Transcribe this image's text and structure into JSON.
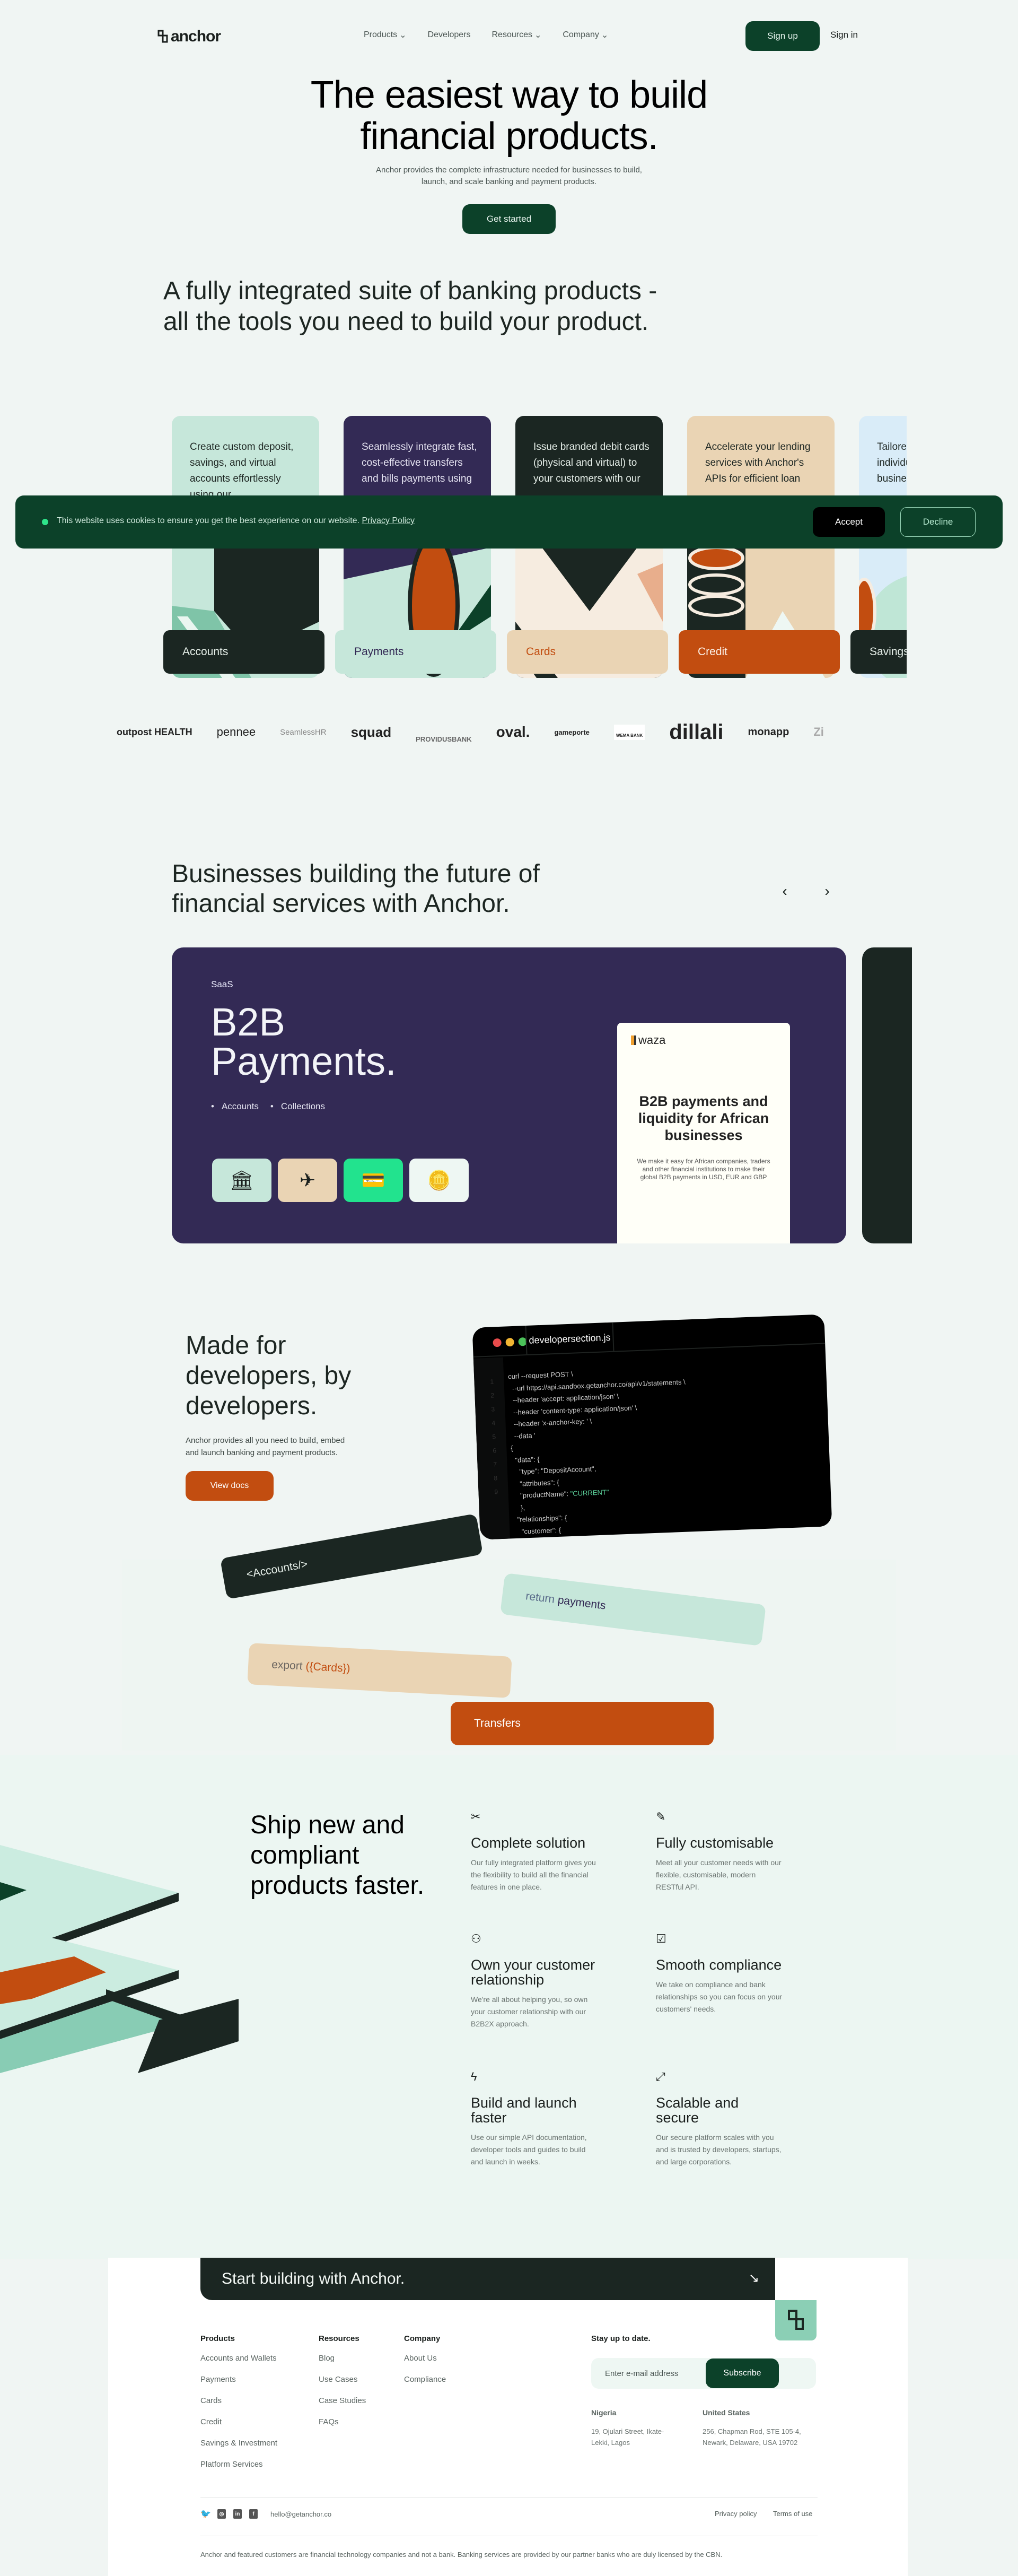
{
  "brand": {
    "name": "anchor"
  },
  "nav": {
    "links": [
      {
        "label": "Products",
        "has_dropdown": true
      },
      {
        "label": "Developers",
        "has_dropdown": false
      },
      {
        "label": "Resources",
        "has_dropdown": true
      },
      {
        "label": "Company",
        "has_dropdown": true
      }
    ],
    "signup_label": "Sign up",
    "signin_label": "Sign in"
  },
  "hero": {
    "title_line1": "The easiest way to build",
    "title_line2": "financial products.",
    "subtitle_line1": "Anchor provides the complete infrastructure needed for businesses to build,",
    "subtitle_line2": "launch, and scale banking and payment products.",
    "cta_label": "Get started"
  },
  "suite": {
    "title_line1": "A fully integrated suite of banking products -",
    "title_line2": "all the tools you need to build your product."
  },
  "products": [
    {
      "label": "Accounts",
      "description": "Create custom deposit, savings, and virtual accounts effortlessly using our",
      "card_color": "#c6e7da",
      "text_color": "#1d2622",
      "label_bg": "#1b2622",
      "label_color": "#e6efe9"
    },
    {
      "label": "Payments",
      "description": "Seamlessly integrate fast, cost-effective transfers and bills payments using",
      "card_color": "#332a55",
      "text_color": "#e6e4f2",
      "label_bg": "#c6e7da",
      "label_color": "#332a55"
    },
    {
      "label": "Cards",
      "description": "Issue branded debit cards (physical and virtual) to your customers with our",
      "card_color": "#1b2622",
      "text_color": "#e6efe9",
      "label_bg": "#ead4b4",
      "label_color": "#c24d10"
    },
    {
      "label": "Credit",
      "description": "Accelerate your lending services with Anchor's APIs for efficient loan",
      "card_color": "#ead4b4",
      "text_color": "#1d2622",
      "label_bg": "#c24d10",
      "label_color": "#fbeee4"
    },
    {
      "label": "Savings",
      "description": "Tailored Investment for individuals and businesses",
      "card_color": "#d9ecf8",
      "text_color": "#1d2622",
      "label_bg": "#1b2622",
      "label_color": "#e6efe9"
    }
  ],
  "cookie": {
    "text": "This website uses cookies to ensure you get the best experience on our website.",
    "link_label": "Privacy Policy",
    "accept_label": "Accept",
    "decline_label": "Decline"
  },
  "partner_logos": [
    "outpost HEALTH",
    "pennee",
    "SeamlessHR",
    "squad",
    "PROVIDUSBANK",
    "oval.",
    "gameporte",
    "WEMA BANK",
    "dillali",
    "monapp",
    "Zi"
  ],
  "businesses": {
    "title_line1": "Businesses building the future of",
    "title_line2": "financial services with Anchor.",
    "prev_icon": "chevron-left-icon",
    "next_icon": "chevron-right-icon",
    "case": {
      "tag": "SaaS",
      "title_line1": "B2B",
      "title_line2": "Payments.",
      "features": [
        "Accounts",
        "Collections"
      ],
      "preview": {
        "logo": "waza",
        "headline": "B2B payments and liquidity for African businesses",
        "body": "We make it easy for African companies, traders and other financial institutions to make their global B2B payments in USD, EUR and GBP"
      }
    }
  },
  "developers": {
    "title_line1": "Made for",
    "title_line2": "developers, by",
    "title_line3": "developers.",
    "subtitle": "Anchor provides all you need to build, embed and launch banking and payment products.",
    "cta_label": "View docs",
    "editor": {
      "filename": "developersection.js",
      "line_numbers": [
        "1",
        "2",
        "3",
        "4",
        "5",
        "6",
        "7",
        "8",
        "9"
      ],
      "code_lines": [
        "curl --request POST \\",
        "  --url https://api.sandbox.getanchor.co/api/v1/statements \\",
        "  --header 'accept: application/json' \\",
        "  --header 'content-type: application/json' \\",
        "  --header 'x-anchor-key: ' \\",
        "  --data '",
        "{",
        "  \"data\": {",
        "    \"type\": \"DepositAccount\",",
        "    \"attributes\": {",
        "    \"productName\": ",
        "    },",
        "  \"relationships\": {",
        "    \"customer\": {"
      ],
      "highlight_value": "\"CURRENT\""
    },
    "chips": {
      "accounts": "<Accounts/>",
      "payments_prefix": "return",
      "payments_word": "payments",
      "cards_prefix": "export",
      "cards_word": "({Cards})",
      "transfers": "Transfers"
    }
  },
  "ship": {
    "title_line1": "Ship new and",
    "title_line2": "compliant",
    "title_line3": "products faster.",
    "features": [
      {
        "icon": "tools-icon",
        "title": "Complete solution",
        "body": "Our fully integrated platform gives you the flexibility to build all the financial features in one place."
      },
      {
        "icon": "edit-document-icon",
        "title": "Fully customisable",
        "body": "Meet all your customer needs with our flexible, customisable, modern RESTful API."
      },
      {
        "icon": "users-icon",
        "title": "Own your customer relationship",
        "body": "We're all about helping you, so own your customer relationship with our B2B2X approach."
      },
      {
        "icon": "clipboard-check-icon",
        "title": "Smooth compliance",
        "body": "We take on compliance and bank relationships so you can focus on your customers' needs."
      },
      {
        "icon": "lightning-icon",
        "title": "Build and launch faster",
        "body": "Use our simple API documentation, developer tools and guides to build and launch in weeks."
      },
      {
        "icon": "scale-arrow-icon",
        "title": "Scalable and secure",
        "body": "Our secure platform scales with you and is trusted by developers, startups, and large corporations."
      }
    ]
  },
  "footer": {
    "cta_label": "Start building with Anchor.",
    "columns": [
      {
        "title": "Products",
        "links": [
          "Accounts and Wallets",
          "Payments",
          "Cards",
          "Credit",
          "Savings & Investment",
          "Platform Services"
        ]
      },
      {
        "title": "Resources",
        "links": [
          "Blog",
          "Use Cases",
          "Case Studies",
          "FAQs"
        ]
      },
      {
        "title": "Company",
        "links": [
          "About Us",
          "Compliance"
        ]
      }
    ],
    "newsletter": {
      "title": "Stay up to date.",
      "placeholder": "Enter e-mail address",
      "button_label": "Subscribe"
    },
    "offices": [
      {
        "country": "Nigeria",
        "address": "19, Ojulari Street, Ikate-Lekki, Lagos"
      },
      {
        "country": "United States",
        "address": "256, Chapman Rod, STE 105-4, Newark, Delaware, USA 19702"
      }
    ],
    "social": [
      "twitter-icon",
      "instagram-icon",
      "linkedin-icon",
      "facebook-icon"
    ],
    "email": "hello@getanchor.co",
    "privacy_label": "Privacy policy",
    "terms_label": "Terms of use",
    "disclaimer": "Anchor and featured customers are financial technology companies and not a bank. Banking services are provided by our partner banks who are duly licensed by the CBN."
  }
}
